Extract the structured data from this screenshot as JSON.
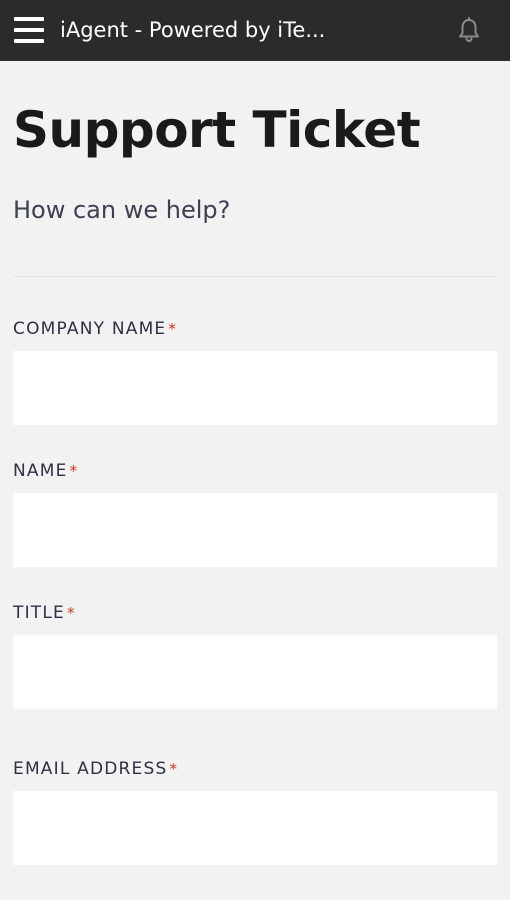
{
  "header": {
    "title": "iAgent - Powered by iTe...",
    "menu_icon": "hamburger-menu-icon",
    "notification_icon": "bell-icon"
  },
  "page": {
    "title": "Support Ticket",
    "subtitle": "How can we help?"
  },
  "form": {
    "required_marker": "*",
    "fields": [
      {
        "label": "COMPANY NAME",
        "value": "",
        "required": true
      },
      {
        "label": "NAME",
        "value": "",
        "required": true
      },
      {
        "label": "TITLE",
        "value": "",
        "required": true
      },
      {
        "label": "EMAIL ADDRESS",
        "value": "",
        "required": true
      }
    ]
  },
  "colors": {
    "topbar": "#2b2b2b",
    "background": "#f2f2f2",
    "required": "#d0341f",
    "label": "#2d3142"
  }
}
